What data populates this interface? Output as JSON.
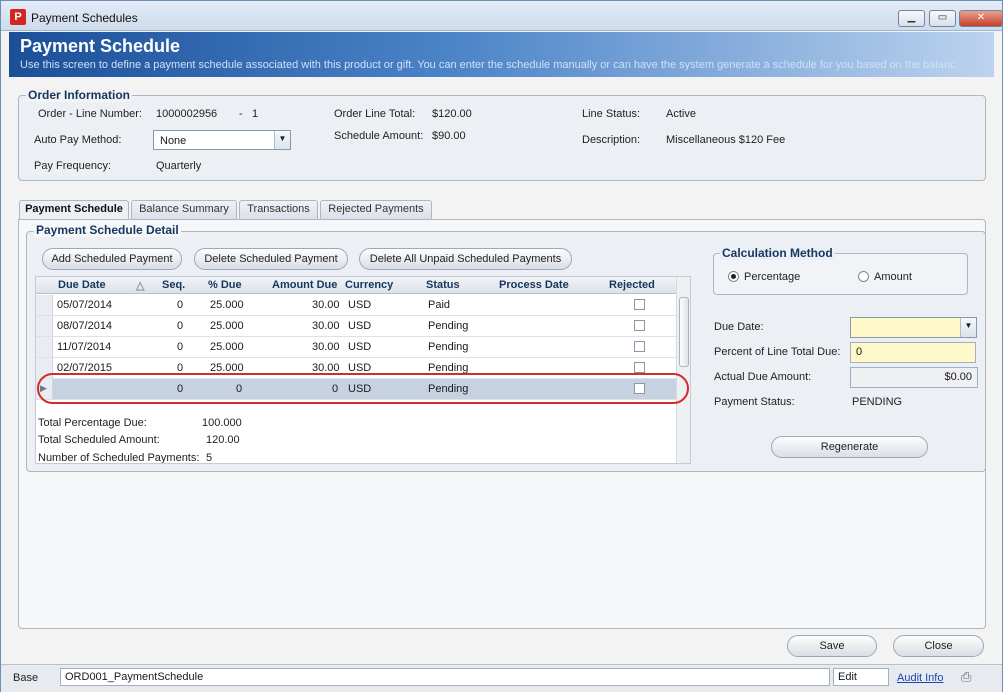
{
  "window": {
    "title": "Payment Schedules",
    "app_icon_letter": "P",
    "minimize": "▁",
    "maximize": "▭",
    "close": "✕"
  },
  "banner": {
    "title": "Payment Schedule",
    "subtitle": "Use this screen to define a payment schedule associated with this product or gift. You can enter the schedule manually or can have the system generate a schedule for you based on the balanc"
  },
  "order_info": {
    "title": "Order Information",
    "order_line_label": "Order - Line Number:",
    "order_number": "1000002956",
    "line_dash": "-",
    "line_number": "1",
    "auto_pay_label": "Auto Pay Method:",
    "auto_pay_value": "None",
    "pay_freq_label": "Pay Frequency:",
    "pay_freq_value": "Quarterly",
    "order_total_label": "Order Line Total:",
    "order_total_value": "$120.00",
    "schedule_amount_label": "Schedule Amount:",
    "schedule_amount_value": "$90.00",
    "line_status_label": "Line Status:",
    "line_status_value": "Active",
    "description_label": "Description:",
    "description_value": "Miscellaneous $120 Fee"
  },
  "tabs": [
    {
      "label": "Payment Schedule",
      "active": true
    },
    {
      "label": "Balance Summary",
      "active": false
    },
    {
      "label": "Transactions",
      "active": false
    },
    {
      "label": "Rejected Payments",
      "active": false
    }
  ],
  "detail": {
    "title": "Payment Schedule Detail",
    "add_button": "Add Scheduled Payment",
    "delete_button": "Delete Scheduled Payment",
    "delete_all_button": "Delete All Unpaid Scheduled Payments",
    "columns": [
      "Due Date",
      "Seq.",
      "% Due",
      "Amount Due",
      "Currency",
      "Status",
      "Process Date",
      "Rejected"
    ],
    "sort_indicator": "△",
    "rows": [
      {
        "due_date": "05/07/2014",
        "seq": "0",
        "pct": "25.000",
        "amount": "30.00",
        "currency": "USD",
        "status": "Paid",
        "process_date": ""
      },
      {
        "due_date": "08/07/2014",
        "seq": "0",
        "pct": "25.000",
        "amount": "30.00",
        "currency": "USD",
        "status": "Pending",
        "process_date": ""
      },
      {
        "due_date": "11/07/2014",
        "seq": "0",
        "pct": "25.000",
        "amount": "30.00",
        "currency": "USD",
        "status": "Pending",
        "process_date": ""
      },
      {
        "due_date": "02/07/2015",
        "seq": "0",
        "pct": "25.000",
        "amount": "30.00",
        "currency": "USD",
        "status": "Pending",
        "process_date": ""
      },
      {
        "due_date": "",
        "seq": "0",
        "pct": "0",
        "amount": "0",
        "currency": "USD",
        "status": "Pending",
        "process_date": ""
      }
    ],
    "total_pct_label": "Total Percentage Due:",
    "total_pct_value": "100.000",
    "total_sched_label": "Total Scheduled Amount:",
    "total_sched_value": "120.00",
    "num_sched_label": "Number of Scheduled Payments:",
    "num_sched_value": "5"
  },
  "calc": {
    "title": "Calculation Method",
    "percentage": "Percentage",
    "amount": "Amount",
    "due_date_label": "Due Date:",
    "pct_label": "Percent of Line Total Due:",
    "pct_value": "0",
    "actual_label": "Actual Due Amount:",
    "actual_value": "$0.00",
    "payment_status_label": "Payment Status:",
    "payment_status_value": "PENDING",
    "regenerate": "Regenerate"
  },
  "footer": {
    "save": "Save",
    "close": "Close"
  },
  "statusbar": {
    "base": "Base",
    "form_name": "ORD001_PaymentSchedule",
    "mode": "Edit",
    "audit": "Audit Info"
  }
}
